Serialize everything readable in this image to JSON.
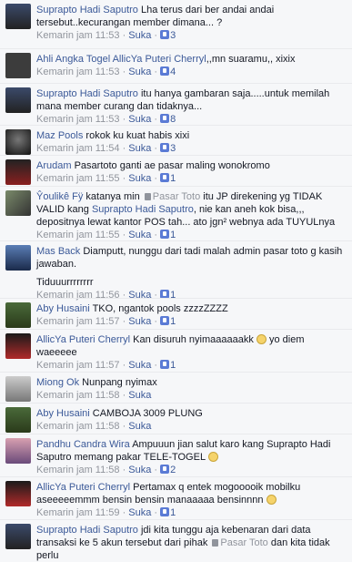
{
  "comments": [
    {
      "author": "Suprapto Hadi Saputro",
      "text": "Lha terus dari ber andai andai tersebut..kecurangan member dimana... ?",
      "time": "Kemarin jam 11:53",
      "like": "Suka",
      "likes": "3"
    },
    {
      "author": "Ahli Angka Togel AllicYa Puteri Cherryl",
      "text": ",,mn suaramu,, xixix",
      "time": "Kemarin jam 11:53",
      "like": "Suka",
      "likes": "4"
    },
    {
      "author": "Suprapto Hadi Saputro",
      "text": "itu hanya gambaran saja.....untuk memilah mana member curang dan tidaknya...",
      "time": "Kemarin jam 11:53",
      "like": "Suka",
      "likes": "8"
    },
    {
      "author": "Maz Pools",
      "text": "rokok ku kuat habis xixi",
      "time": "Kemarin jam 11:54",
      "like": "Suka",
      "likes": "3"
    },
    {
      "author": "Arudam",
      "text": "Pasartoto ganti ae pasar maling wonokromo",
      "time": "Kemarin jam 11:55",
      "like": "Suka",
      "likes": "1"
    },
    {
      "author": "Ŷoulikê Fÿ",
      "text_pre": "katanya min",
      "mention_tag": "Pasar Toto",
      "text_mid": "itu JP direkening yg TIDAK VALID kang",
      "mention2": "Suprapto Hadi Saputro",
      "text_post": ", nie kan aneh kok bisa,,, depositnya lewat kantor POS tah... ato jgn² webnya ada TUYULnya",
      "time": "Kemarin jam 11:55",
      "like": "Suka",
      "likes": "1"
    },
    {
      "author": "Mas Back",
      "text": "Diamputt, nunggu dari tadi malah admin pasar toto g kasih jawaban.",
      "text2": "Tiduuurrrrrrrr",
      "time": "Kemarin jam 11:56",
      "like": "Suka",
      "likes": "1"
    },
    {
      "author": "Aby Husaini",
      "text": "TKO, ngantok pools zzzzZZZZ",
      "time": "Kemarin jam 11:57",
      "like": "Suka",
      "likes": "1"
    },
    {
      "author": "AllicYa Puteri Cherryl",
      "text": "Kan disuruh nyimaaaaaakk",
      "text_post": "yo diem waeeeee",
      "time": "Kemarin jam 11:57",
      "like": "Suka",
      "likes": "1"
    },
    {
      "author": "Miong Ok",
      "text": "Nunpang nyimax",
      "time": "Kemarin jam 11:58",
      "like": "Suka"
    },
    {
      "author": "Aby Husaini",
      "text": "CAMBOJA 3009 PLUNG",
      "time": "Kemarin jam 11:58",
      "like": "Suka"
    },
    {
      "author": "Pandhu Candra Wira",
      "text": "Ampuuun jian salut karo kang Suprapto Hadi Saputro memang pakar TELE-TOGEL",
      "time": "Kemarin jam 11:58",
      "like": "Suka",
      "likes": "2"
    },
    {
      "author": "AllicYa Puteri Cherryl",
      "text": "Pertamax q entek mogooooik mobilku aseeeeemmm bensin bensin manaaaaa bensinnnn",
      "time": "Kemarin jam 11:59",
      "like": "Suka",
      "likes": "1"
    },
    {
      "author": "Suprapto Hadi Saputro",
      "text": "jdi kita tunggu aja kebenaran dari data transaksi ke 5 akun tersebut dari pihak",
      "mention_tag": "Pasar Toto",
      "text_post": "dan kita tidak perlu"
    }
  ],
  "colors": {
    "link": "#3b5998",
    "meta": "#90949c",
    "bg": "#f6f7f9"
  }
}
